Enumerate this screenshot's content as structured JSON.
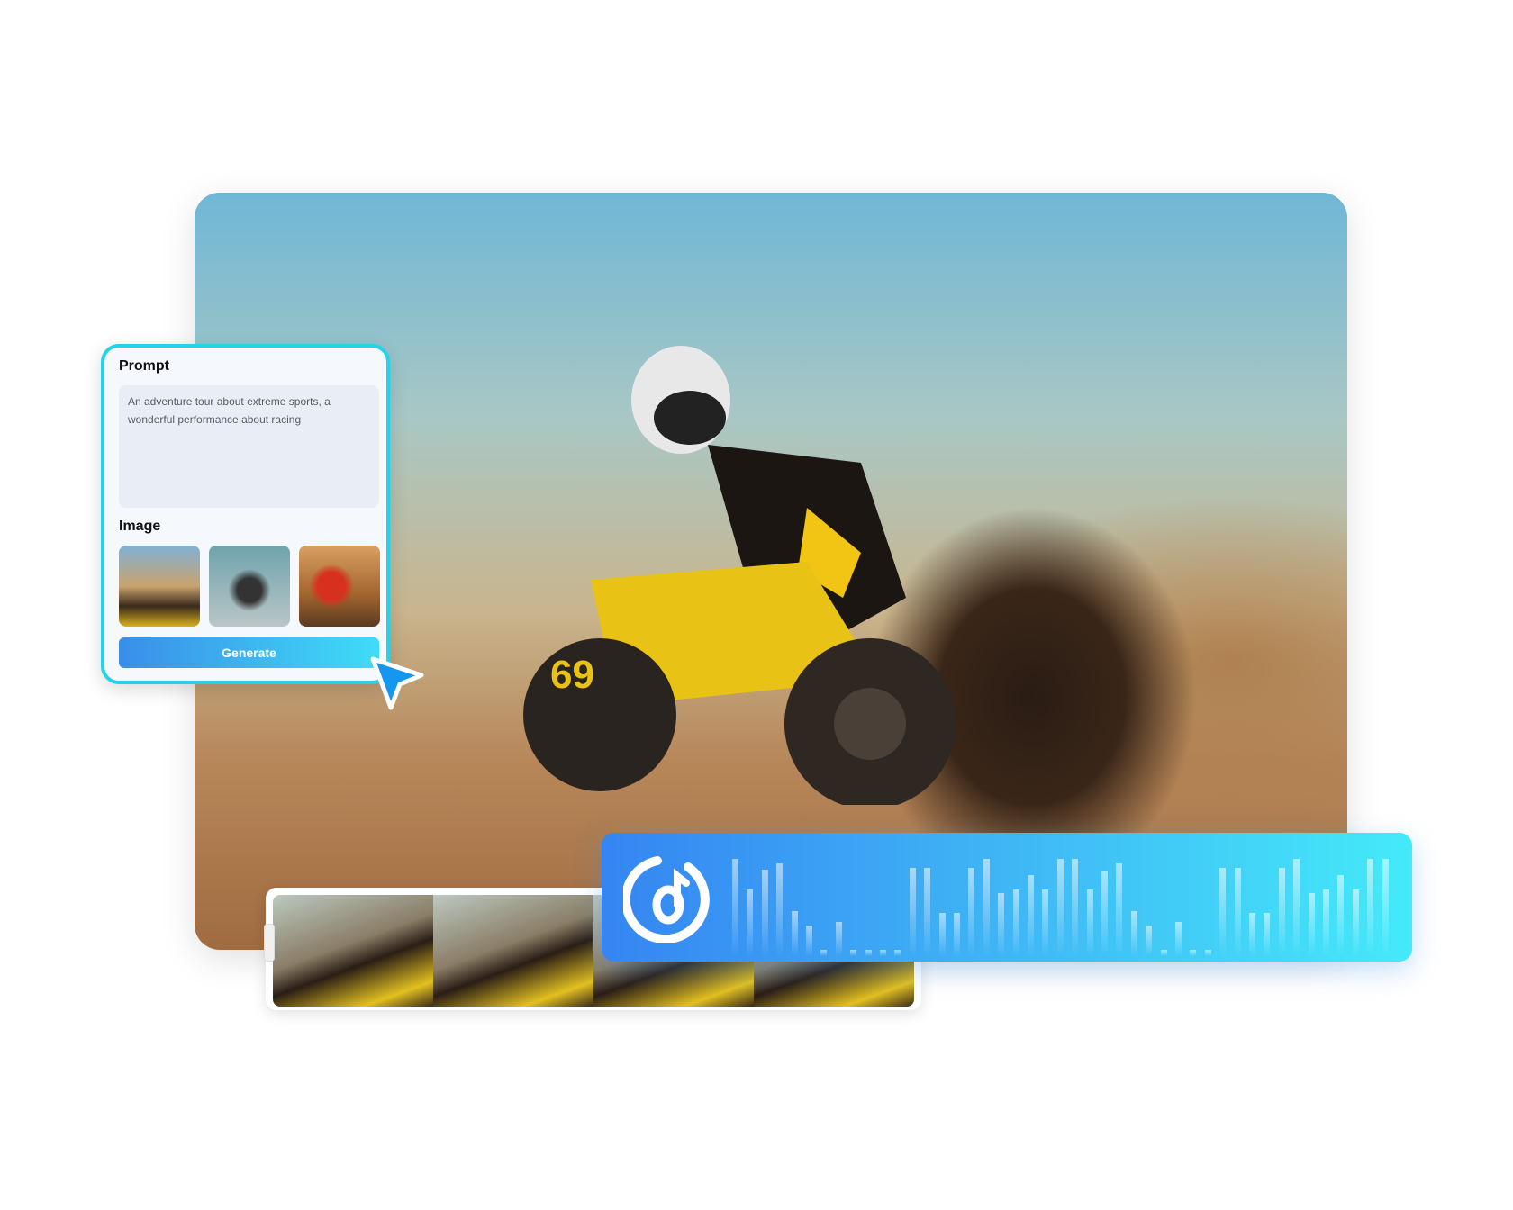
{
  "prompt_card": {
    "prompt_label": "Prompt",
    "prompt_text": "An adventure tour about extreme sports, a wonderful performance about racing",
    "image_label": "Image",
    "generate_label": "Generate",
    "border_color": "#25d3e8"
  },
  "audio_track": {
    "icon": "music-note-icon",
    "levels": [
      0.9,
      0.62,
      0.8,
      0.86,
      0.42,
      0.28,
      0,
      0.32,
      0,
      0,
      0,
      0,
      0.82,
      0.82,
      0.4,
      0.4,
      0.82,
      0.9,
      0.58,
      0.62,
      0.75,
      0.62,
      0.9,
      0.9,
      0.62,
      0.78,
      0.86,
      0.42,
      0.28,
      0,
      0.32,
      0,
      0,
      0.82,
      0.82,
      0.4,
      0.4,
      0.82,
      0.9,
      0.58,
      0.62,
      0.75,
      0.62,
      0.9,
      0.9
    ]
  },
  "filmstrip": {
    "frame_count": 4
  }
}
